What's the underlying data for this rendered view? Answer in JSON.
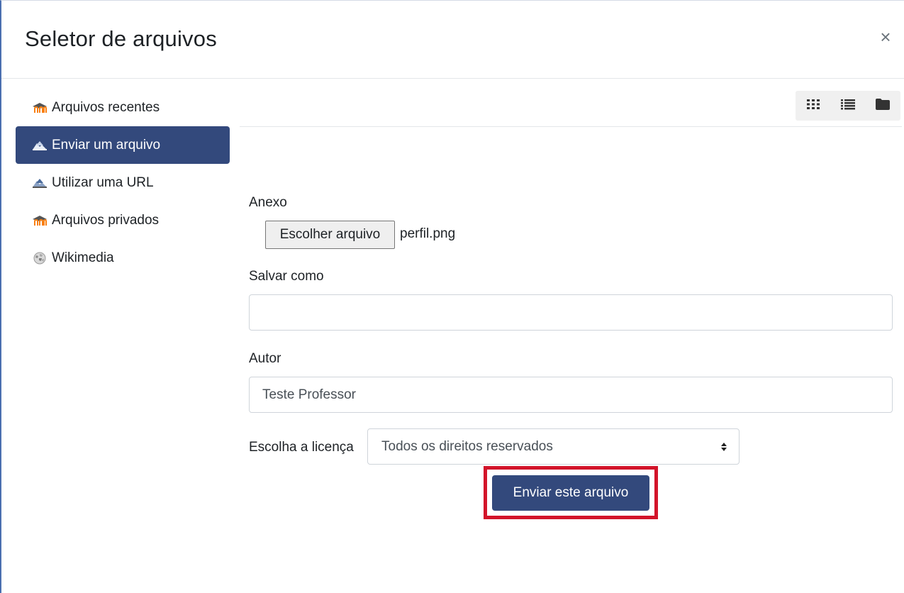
{
  "dialog": {
    "title": "Seletor de arquivos",
    "close_symbol": "×"
  },
  "sidebar": {
    "items": [
      {
        "label": "Arquivos recentes",
        "icon": "moodle-icon",
        "active": false
      },
      {
        "label": "Enviar um arquivo",
        "icon": "upload-icon",
        "active": true
      },
      {
        "label": "Utilizar uma URL",
        "icon": "url-icon",
        "active": false
      },
      {
        "label": "Arquivos privados",
        "icon": "moodle-icon",
        "active": false
      },
      {
        "label": "Wikimedia",
        "icon": "wikimedia-icon",
        "active": false
      }
    ]
  },
  "toolbar": {
    "views": [
      "grid-view-icon",
      "list-view-icon",
      "folder-view-icon"
    ]
  },
  "form": {
    "attachment_label": "Anexo",
    "choose_file_label": "Escolher arquivo",
    "file_name": "perfil.png",
    "save_as_label": "Salvar como",
    "save_as_value": "",
    "author_label": "Autor",
    "author_value": "Teste Professor",
    "license_label": "Escolha a licença",
    "license_value": "Todos os direitos reservados",
    "submit_label": "Enviar este arquivo"
  },
  "colors": {
    "primary": "#33497c",
    "highlight": "#d3142a",
    "moodle_orange": "#f98012"
  }
}
